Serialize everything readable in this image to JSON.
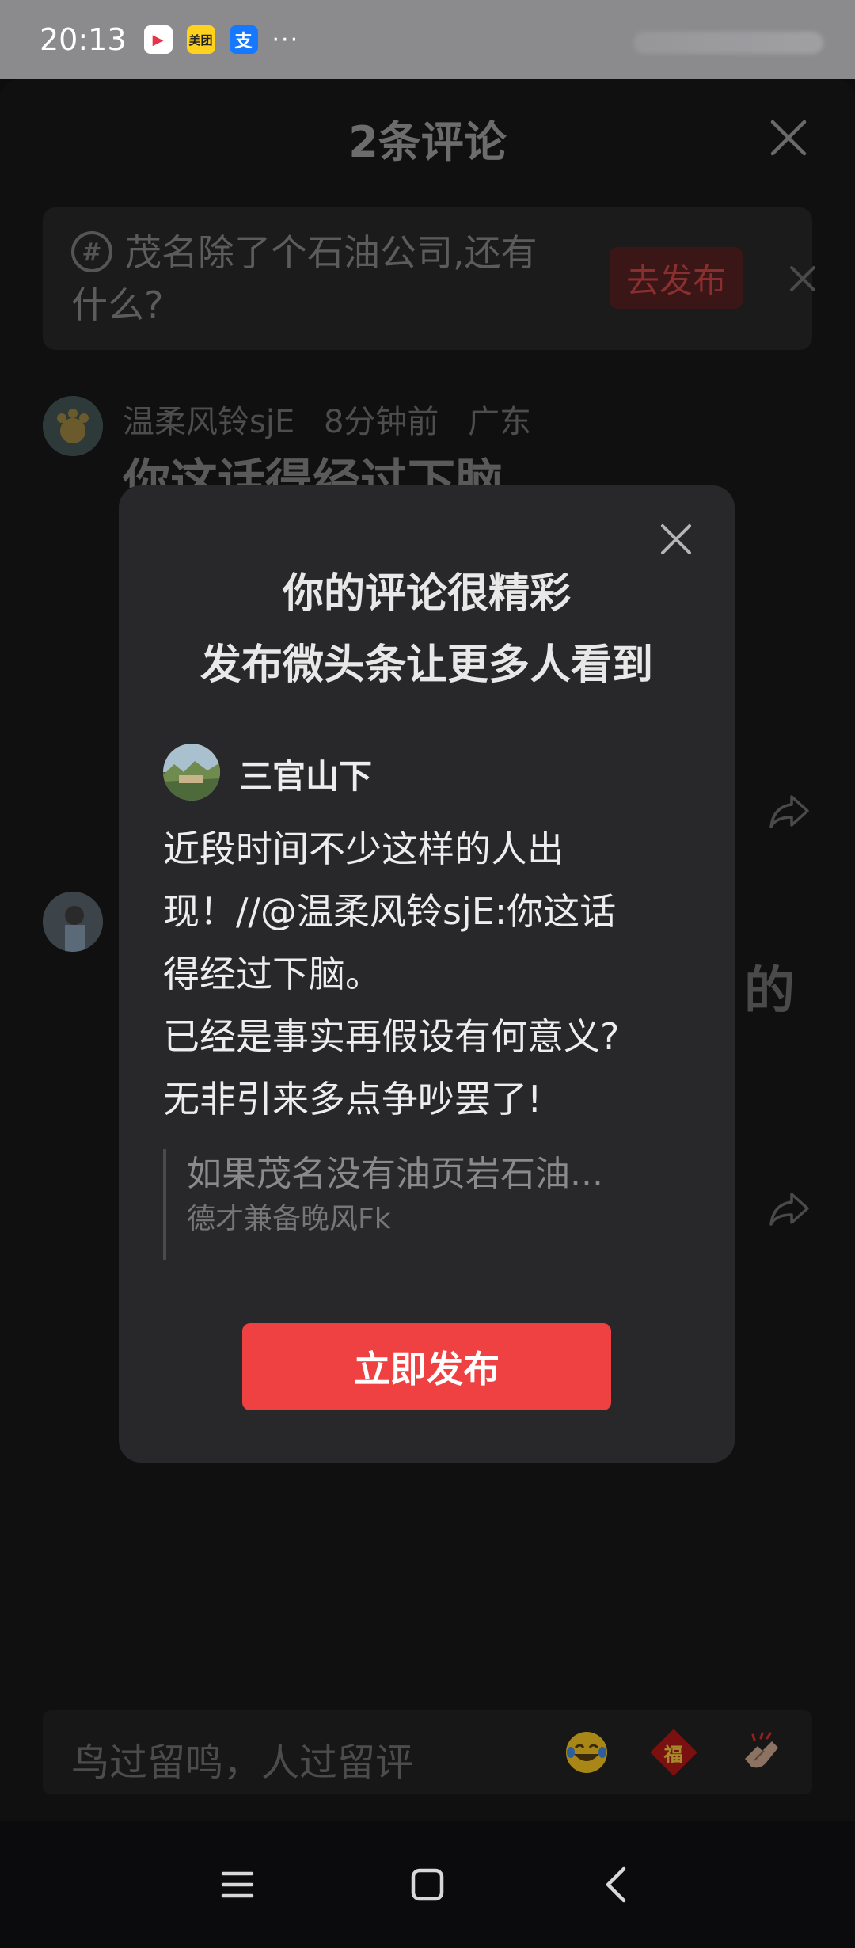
{
  "status_bar": {
    "time": "20:13",
    "apps": [
      {
        "name": "video-app-icon",
        "glyph": "▶"
      },
      {
        "name": "meituan-app-icon",
        "glyph": "美团"
      },
      {
        "name": "alipay-app-icon",
        "glyph": "支"
      }
    ],
    "more": "···"
  },
  "sheet": {
    "title": "2条评论",
    "topic": {
      "icon": "#",
      "text": "茂名除了个石油公司,还有什么?",
      "publish_label": "去发布"
    },
    "comment1": {
      "author": "温柔风铃sjE",
      "time": "8分钟前",
      "location": "广东",
      "body": "你这话得经过下脑"
    },
    "partial_right_text": "的"
  },
  "modal": {
    "title_line1": "你的评论很精彩",
    "title_line2": "发布微头条让更多人看到",
    "post": {
      "author": "三官山下",
      "lines": [
        "近段时间不少这样的人出",
        "现！//@温柔风铃sjE:你这话",
        "得经过下脑。",
        "已经是事实再假设有何意义?",
        "无非引来多点争吵罢了!"
      ],
      "quote_text": "如果茂名没有油页岩石油...",
      "quote_author": "德才兼备晚风Fk"
    },
    "publish_label": "立即发布"
  },
  "input": {
    "placeholder": "鸟过留鸣，人过留评",
    "emoji_fu": "福"
  },
  "colors": {
    "accent": "#f04142",
    "modal_bg": "#28282a",
    "background": "#101010"
  }
}
